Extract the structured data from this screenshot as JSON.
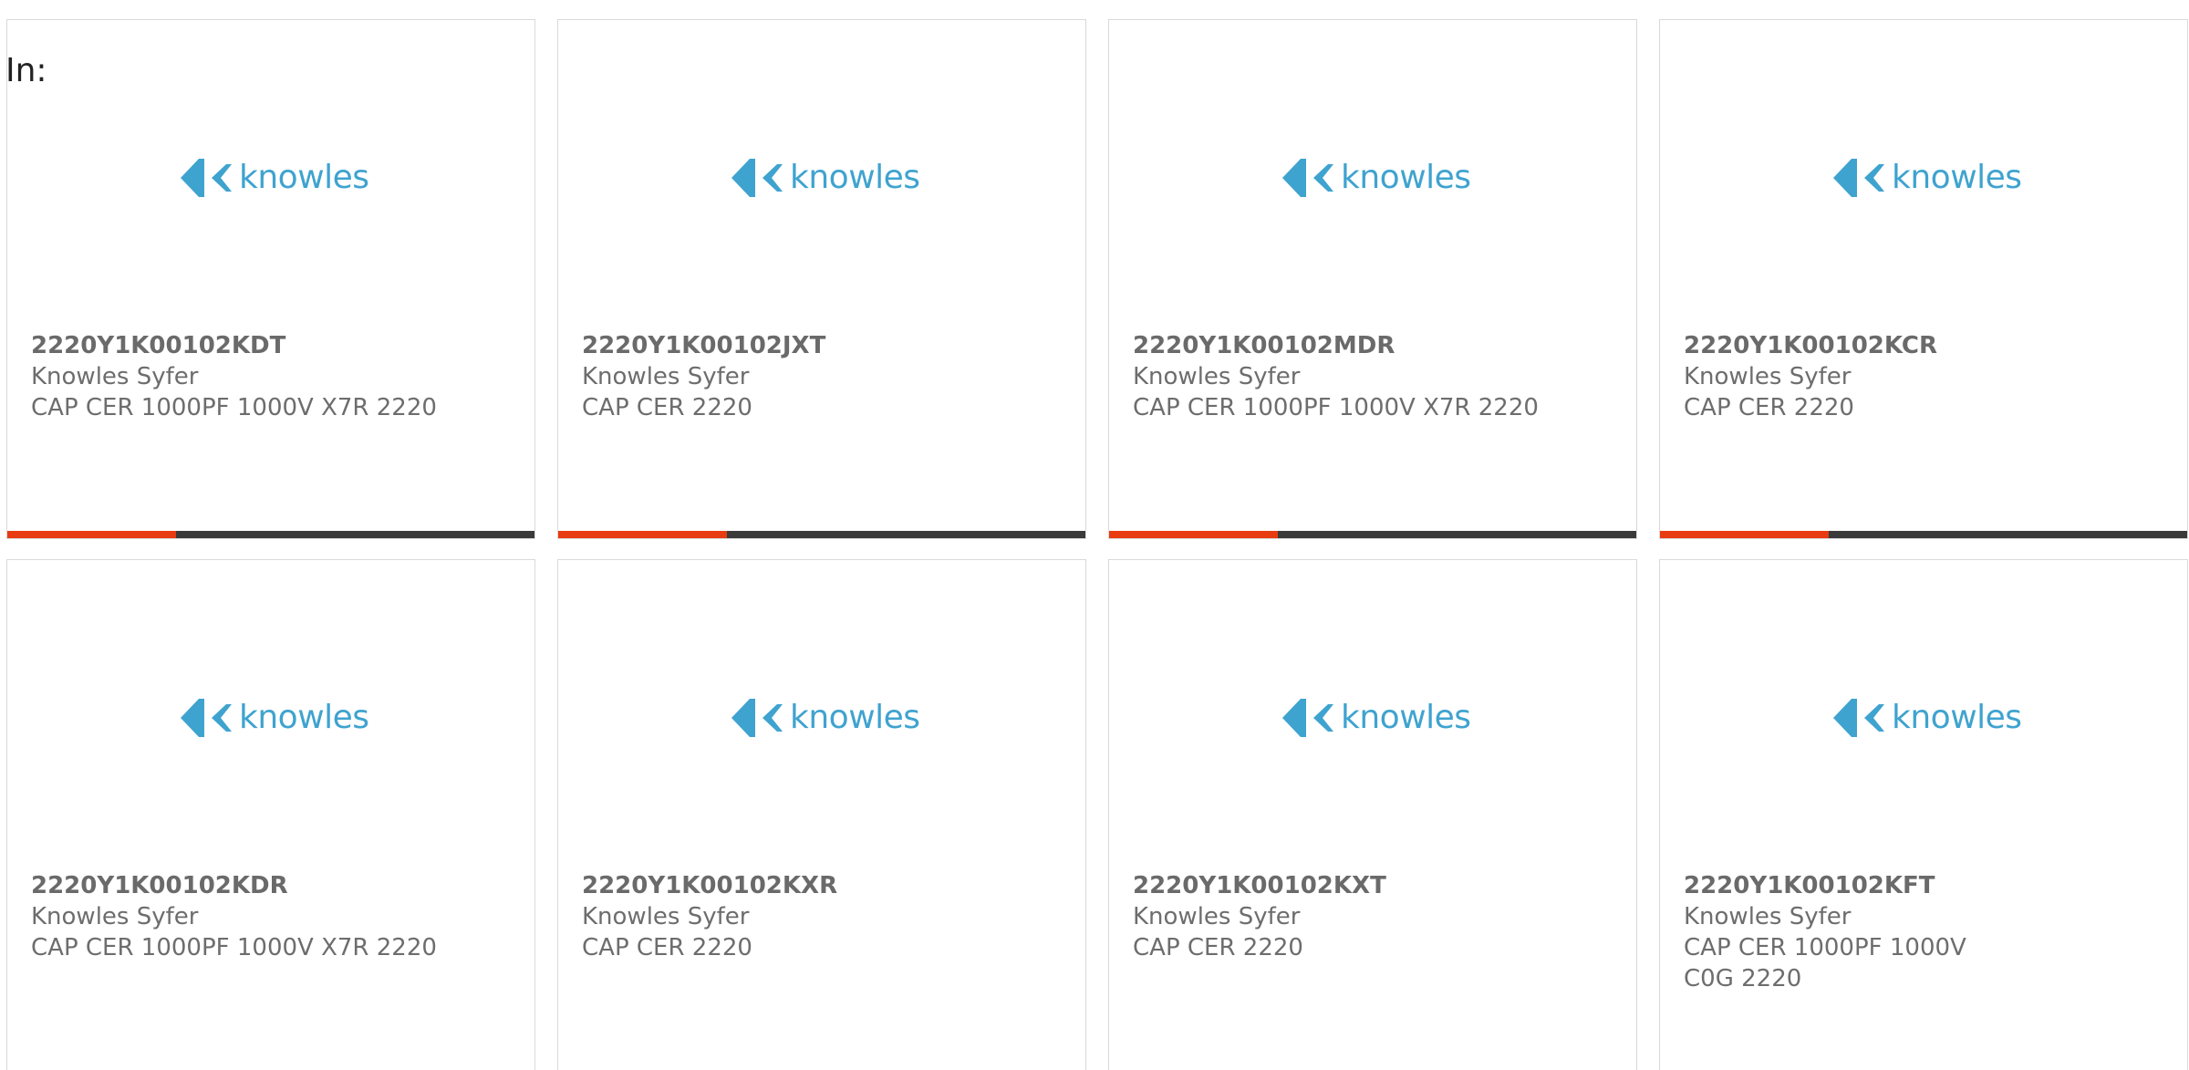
{
  "scope_label": "In:",
  "colors": {
    "logo": "#3fa3cf",
    "bar_accent": "#e83b12",
    "bar_track": "#3a3a3a",
    "card_border": "#d9d9d9"
  },
  "logo_text": "knowles",
  "cards": [
    {
      "part": "2220Y1K00102KDT",
      "manufacturer": "Knowles Syfer",
      "description": "CAP CER 1000PF 1000V X7R 2220",
      "progress": 0.32
    },
    {
      "part": "2220Y1K00102JXT",
      "manufacturer": "Knowles Syfer",
      "description": "CAP CER 2220",
      "progress": 0.32
    },
    {
      "part": "2220Y1K00102MDR",
      "manufacturer": "Knowles Syfer",
      "description": "CAP CER 1000PF 1000V X7R 2220",
      "progress": 0.32
    },
    {
      "part": "2220Y1K00102KCR",
      "manufacturer": "Knowles Syfer",
      "description": "CAP CER 2220",
      "progress": 0.32
    },
    {
      "part": "2220Y1K00102KDR",
      "manufacturer": "Knowles Syfer",
      "description": "CAP CER 1000PF 1000V X7R 2220"
    },
    {
      "part": "2220Y1K00102KXR",
      "manufacturer": "Knowles Syfer",
      "description": "CAP CER 2220"
    },
    {
      "part": "2220Y1K00102KXT",
      "manufacturer": "Knowles Syfer",
      "description": "CAP CER 2220"
    },
    {
      "part": "2220Y1K00102KFT",
      "manufacturer": "Knowles Syfer",
      "description": "CAP CER 1000PF 1000V C0G 2220"
    }
  ]
}
